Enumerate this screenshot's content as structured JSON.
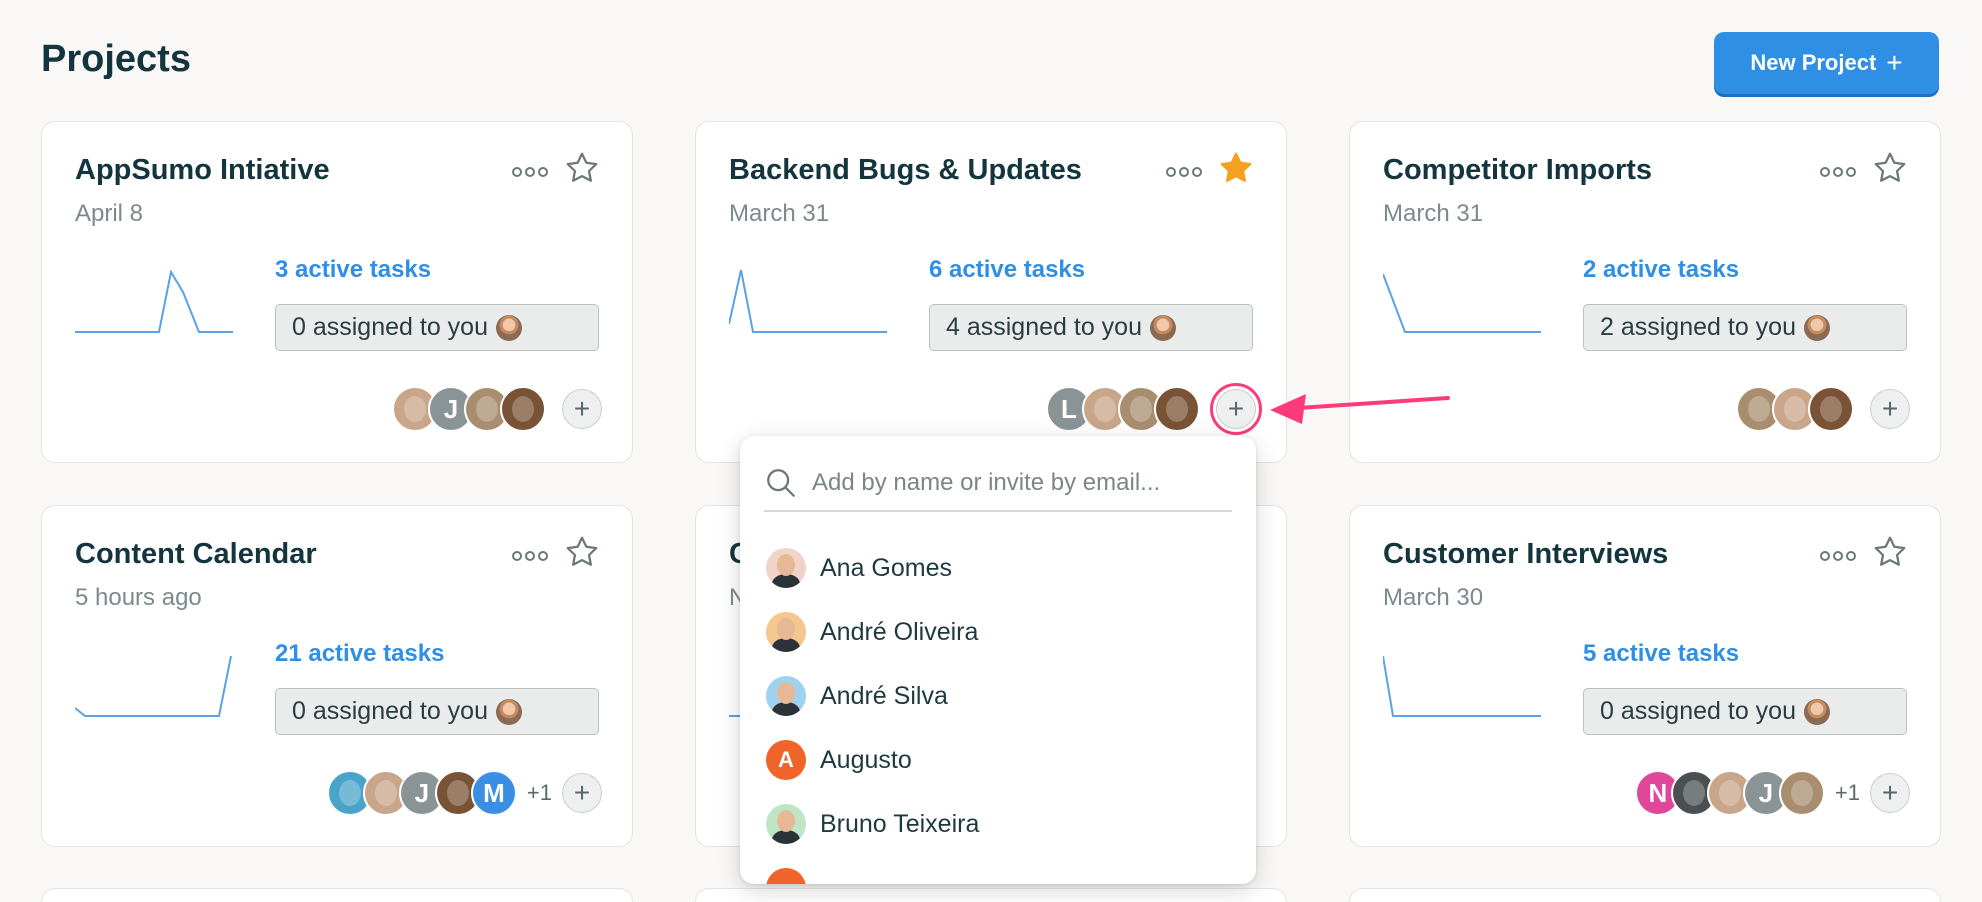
{
  "page": {
    "title": "Projects",
    "new_project_label": "New Project"
  },
  "cards": [
    {
      "title": "AppSumo Intiative",
      "date": "April 8",
      "active_tasks": "3 active tasks",
      "assigned": "0 assigned to you",
      "starred": false,
      "members": [
        {
          "kind": "photo",
          "color": "#c9a58a"
        },
        {
          "kind": "initial",
          "initial": "J",
          "color": "#8a9497"
        },
        {
          "kind": "photo",
          "color": "#a88e6e"
        },
        {
          "kind": "photo",
          "color": "#7a5236"
        }
      ],
      "more": ""
    },
    {
      "title": "Backend Bugs & Updates",
      "date": "March 31",
      "active_tasks": "6 active tasks",
      "assigned": "4 assigned to you",
      "starred": true,
      "members": [
        {
          "kind": "initial",
          "initial": "L",
          "color": "#8a9497"
        },
        {
          "kind": "photo",
          "color": "#c9a58a"
        },
        {
          "kind": "photo",
          "color": "#a88e6e"
        },
        {
          "kind": "photo",
          "color": "#7a5236"
        }
      ],
      "more": ""
    },
    {
      "title": "Competitor Imports",
      "date": "March 31",
      "active_tasks": "2 active tasks",
      "assigned": "2 assigned to you",
      "starred": false,
      "members": [
        {
          "kind": "photo",
          "color": "#a88e6e"
        },
        {
          "kind": "photo",
          "color": "#c9a58a"
        },
        {
          "kind": "photo",
          "color": "#7a5236"
        }
      ],
      "more": ""
    },
    {
      "title": "Content Calendar",
      "date": "5 hours ago",
      "active_tasks": "21 active tasks",
      "assigned": "0 assigned to you",
      "starred": false,
      "members": [
        {
          "kind": "photo",
          "color": "#4aa3c8"
        },
        {
          "kind": "photo",
          "color": "#c9a58a"
        },
        {
          "kind": "initial",
          "initial": "J",
          "color": "#8a9497"
        },
        {
          "kind": "photo",
          "color": "#7a5236"
        },
        {
          "kind": "initial",
          "initial": "M",
          "color": "#3a8ee6"
        }
      ],
      "more": "+1"
    },
    {
      "title": "C",
      "date": "N",
      "active_tasks": "",
      "assigned": "",
      "starred": false,
      "members": [],
      "more": ""
    },
    {
      "title": "Customer Interviews",
      "date": "March 30",
      "active_tasks": "5 active tasks",
      "assigned": "0 assigned to you",
      "starred": false,
      "members": [
        {
          "kind": "initial",
          "initial": "N",
          "color": "#e0479a"
        },
        {
          "kind": "photo",
          "color": "#4a5052"
        },
        {
          "kind": "photo",
          "color": "#c9a58a"
        },
        {
          "kind": "initial",
          "initial": "J",
          "color": "#8a9497"
        },
        {
          "kind": "photo",
          "color": "#a88e6e"
        }
      ],
      "more": "+1"
    }
  ],
  "dropdown": {
    "placeholder": "Add by name or invite by email...",
    "people": [
      {
        "name": "Ana Gomes",
        "kind": "photo",
        "color": "#f2d3c8"
      },
      {
        "name": "André Oliveira",
        "kind": "photo",
        "color": "#f6c68f"
      },
      {
        "name": "André Silva",
        "kind": "photo",
        "color": "#9ed3f0"
      },
      {
        "name": "Augusto",
        "kind": "initial",
        "initial": "A",
        "color": "#f0642a"
      },
      {
        "name": "Bruno Teixeira",
        "kind": "photo",
        "color": "#bfe6c4"
      }
    ]
  },
  "colors": {
    "accent": "#2f8fe4",
    "star_active": "#f5a020",
    "highlight": "#ff3a7a"
  }
}
